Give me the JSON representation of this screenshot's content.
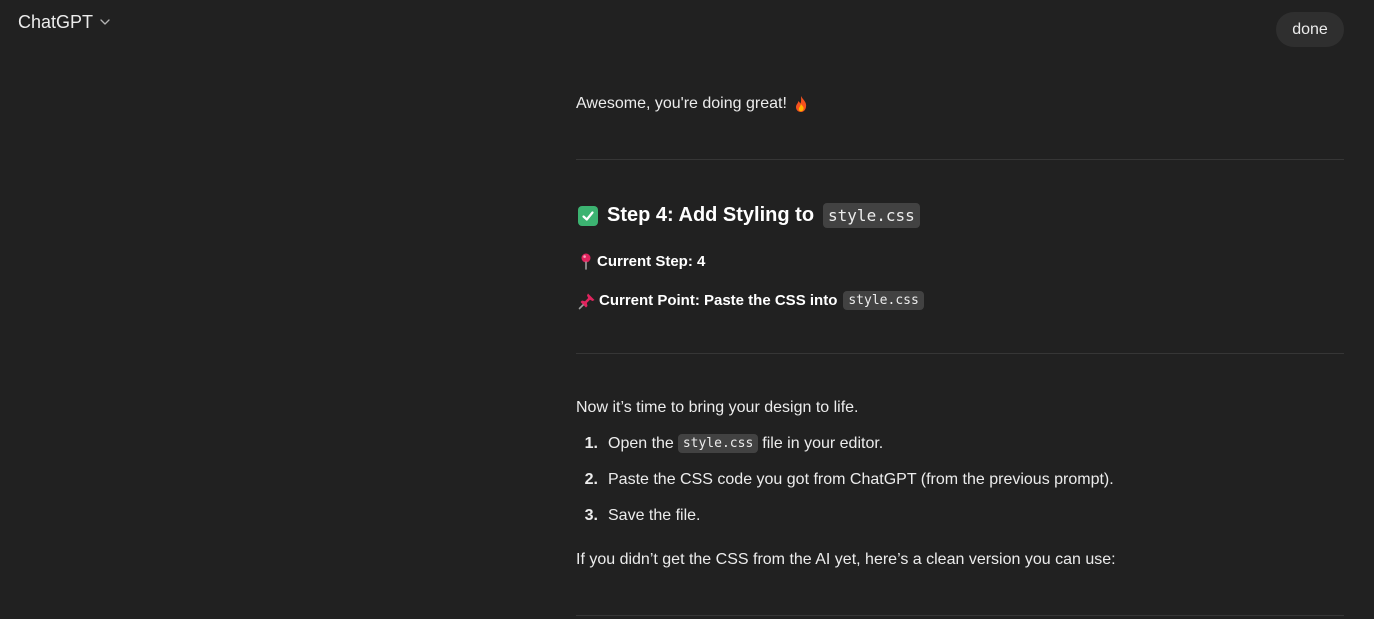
{
  "header": {
    "model_name": "ChatGPT",
    "done_label": "done"
  },
  "message": {
    "intro": "Awesome, you're doing great!",
    "step_heading": {
      "prefix": "Step 4: Add Styling to",
      "code": "style.css"
    },
    "current_step": {
      "label": "Current Step: 4"
    },
    "current_point": {
      "label": "Current Point: Paste the CSS into",
      "code": "style.css"
    },
    "body_intro": "Now it’s time to bring your design to life.",
    "steps": [
      {
        "num": "1.",
        "before": "Open the",
        "code": "style.css",
        "after": "file in your editor."
      },
      {
        "num": "2.",
        "text": "Paste the CSS code you got from ChatGPT (from the previous prompt)."
      },
      {
        "num": "3.",
        "text": "Save the file."
      }
    ],
    "outro": "If you didn’t get the CSS from the AI yet, here’s a clean version you can use:"
  },
  "icons": {
    "fire": "fire-icon",
    "check": "check-mark-button-icon",
    "pin": "round-pushpin-icon",
    "pushpin": "pushpin-icon"
  },
  "colors": {
    "background": "#212121",
    "button_bg": "#2f2f2f",
    "code_bg": "#424242",
    "divider": "#363636",
    "check_green": "#3cb371"
  }
}
